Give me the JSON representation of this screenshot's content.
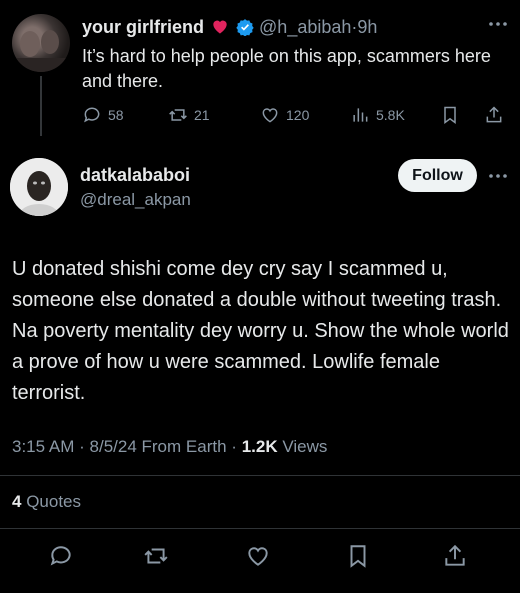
{
  "parent_tweet": {
    "display_name": "your girlfriend",
    "handle": "@h_abibah",
    "separator": "·",
    "time": "9h",
    "text": "It’s hard to help people on this app, scammers here and there.",
    "replies": "58",
    "reposts": "21",
    "likes": "120",
    "views": "5.8K"
  },
  "main_tweet": {
    "display_name": "datkalababoi",
    "handle": "@dreal_akpan",
    "follow_label": "Follow",
    "text": "U donated shishi come dey cry say I scammed u, someone else donated a double without tweeting trash. Na poverty mentality dey worry u. Show the whole world a prove of how u were scammed. Lowlife female terrorist.",
    "time": "3:15 AM",
    "date": "8/5/24",
    "source": "From Earth",
    "views_count": "1.2K",
    "views_label": "Views",
    "meta_sep": "·",
    "quotes_count": "4",
    "quotes_label": "Quotes"
  },
  "colors": {
    "background": "#000000",
    "text": "#e7e9ea",
    "muted": "#8b98a5",
    "verified": "#1d9bf0",
    "heart": "#e0245e"
  },
  "icons": [
    "reply-icon",
    "repost-icon",
    "like-icon",
    "views-icon",
    "bookmark-icon",
    "share-icon",
    "verified-icon",
    "heart-emoji",
    "more-icon"
  ]
}
